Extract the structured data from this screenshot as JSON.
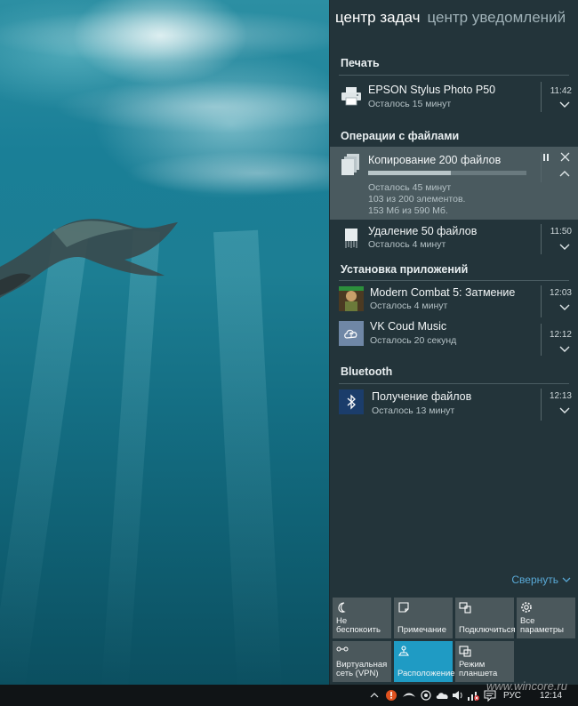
{
  "action_center": {
    "tabs": [
      {
        "label": "центр задач",
        "active": true
      },
      {
        "label": "центр уведомлений",
        "active": false
      }
    ],
    "groups": [
      {
        "title": "Печать",
        "items": [
          {
            "title": "EPSON Stylus Photo P50",
            "subtitle": "Осталось 15 минут",
            "time": "11:42",
            "icon": "printer-icon"
          }
        ]
      },
      {
        "title": "Операции с файлами",
        "items": [
          {
            "title": "Копирование 200 файлов",
            "details": [
              "Осталось 45 минут",
              "103 из 200 элементов.",
              "153 Мб из 590 Мб."
            ],
            "progress": 0.52,
            "icon": "copy-files-icon",
            "expanded": true
          },
          {
            "title": "Удаление 50 файлов",
            "subtitle": "Осталось 4 минут",
            "time": "11:50",
            "icon": "delete-files-icon"
          }
        ]
      },
      {
        "title": "Установка приложений",
        "items": [
          {
            "title": "Modern Combat 5: Затмение",
            "subtitle": "Осталось 4 минут",
            "time": "12:03",
            "icon": "game-app-icon"
          },
          {
            "title": "VK Coud Music",
            "subtitle": "Осталось 20 секунд",
            "time": "12:12",
            "icon": "cloud-music-icon"
          }
        ]
      },
      {
        "title": "Bluetooth",
        "items": [
          {
            "title": "Получение файлов",
            "subtitle": "Осталось 13 минут",
            "time": "12:13",
            "icon": "bluetooth-icon"
          }
        ]
      }
    ],
    "collapse_label": "Свернуть",
    "quick_actions": [
      {
        "label": "Не\nбеспокоить",
        "icon": "moon-icon",
        "on": false
      },
      {
        "label": "Примечание",
        "icon": "note-icon",
        "on": false
      },
      {
        "label": "Подключиться",
        "icon": "connect-icon",
        "on": false
      },
      {
        "label": "Все\nпараметры",
        "icon": "gear-icon",
        "on": false
      },
      {
        "label": "Виртуальная\nсеть (VPN)",
        "icon": "vpn-icon",
        "on": false
      },
      {
        "label": "Расположение",
        "icon": "location-icon",
        "on": true
      },
      {
        "label": "Режим\nпланшета",
        "icon": "tablet-mode-icon",
        "on": false
      }
    ]
  },
  "taskbar": {
    "language": "РУС",
    "clock": "12:14"
  },
  "watermark": "www.wincore.ru",
  "colors": {
    "panel_bg": "#24343a",
    "accent": "#1f9bc4",
    "link": "#59a9d6",
    "taskbar_bg": "#101416"
  }
}
